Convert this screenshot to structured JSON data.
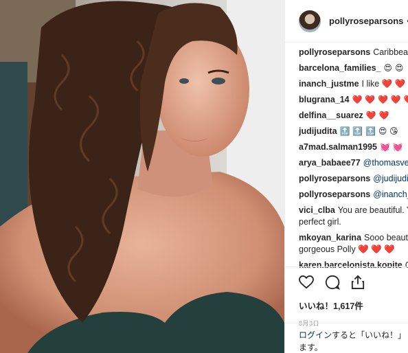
{
  "post": {
    "username": "pollyroseparsons",
    "header_dot": "•"
  },
  "comments": [
    {
      "user": "pollyroseparsons",
      "text": "Caribbean"
    },
    {
      "user": "barcelona_families_",
      "text": "😍 😍"
    },
    {
      "user": "inanch_justme",
      "text": "I like ❤️ ❤️ 😍"
    },
    {
      "user": "blugrana_14",
      "text": "❤️ ❤️ ❤️ ❤️ ❤️"
    },
    {
      "user": "delfina__suarez",
      "text": "❤️ ❤️"
    },
    {
      "user": "judijudita",
      "text": "🔝 🔝 🔝 😍 😘"
    },
    {
      "user": "a7mad.salman1995",
      "text": "💓 💓"
    },
    {
      "user": "arya_babaee77",
      "text": "@thomasver"
    },
    {
      "user": "pollyroseparsons",
      "text": "@judijudita"
    },
    {
      "user": "pollyroseparsons",
      "text": "@inanch_j"
    },
    {
      "user": "vici_clba",
      "text": "You are beautiful. Yo perfect girl."
    },
    {
      "user": "mkoyan_karina",
      "text": "Sooo beautif gorgeous Polly ❤️ ❤️ ❤️"
    },
    {
      "user": "karen.barcelonista.kopite",
      "text": "C 💯"
    }
  ],
  "actions": {
    "like_icon": "heart-outline-icon",
    "comment_icon": "speech-bubble-icon",
    "share_icon": "share-upload-icon",
    "likes_text": "いいね！1,617件",
    "date_text": "8月3日"
  },
  "login": {
    "link_text": "ログイン",
    "rest_text": "すると「いいね！」",
    "second_line": "ます。"
  },
  "colors": {
    "link": "#003569",
    "heart": "#e0245e",
    "border": "#efefef"
  }
}
